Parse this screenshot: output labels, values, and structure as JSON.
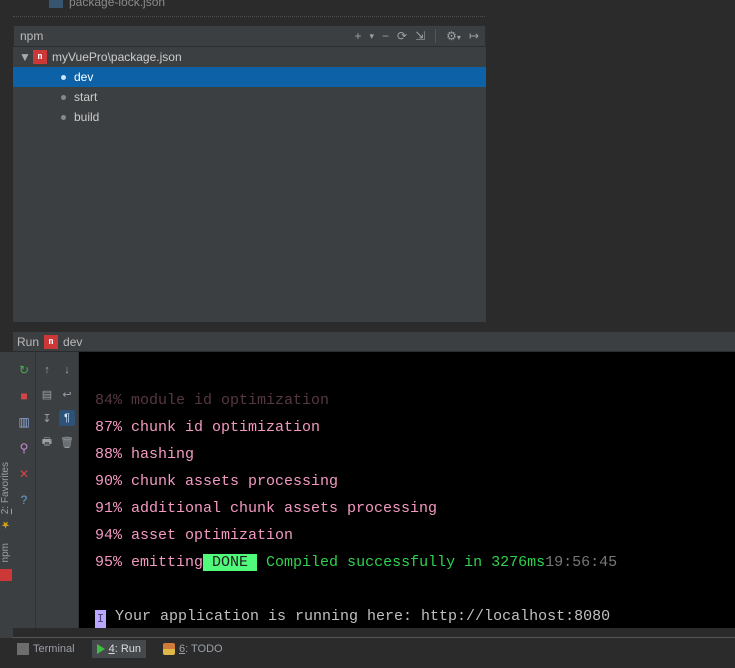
{
  "project_tree": {
    "visible_file": "package-lock.json"
  },
  "npm_toolwindow": {
    "title": "npm",
    "package_file": "myVuePro\\package.json",
    "npm_icon_text": "n",
    "scripts": [
      {
        "name": "dev",
        "selected": true
      },
      {
        "name": "start",
        "selected": false
      },
      {
        "name": "build",
        "selected": false
      }
    ],
    "toolbar": {
      "add": "+",
      "remove": "−",
      "sync": "⟳",
      "expand": "⇲",
      "settings": "⚙",
      "hide": "↦"
    }
  },
  "run_tool": {
    "label_prefix": "Run",
    "config_name": "dev",
    "npm_icon_text": "n"
  },
  "console": {
    "lines": [
      {
        "cls": "pink",
        "text": "87% chunk id optimization"
      },
      {
        "cls": "pink",
        "text": "88% hashing"
      },
      {
        "cls": "pink",
        "text": "90% chunk assets processing"
      },
      {
        "cls": "pink",
        "text": "91% additional chunk assets processing"
      },
      {
        "cls": "pink",
        "text": "94% asset optimization"
      }
    ],
    "emit_prefix": "95% emitting",
    "done_badge": " DONE ",
    "compiled_text": " Compiled successfully in 3276ms",
    "timestamp": "19:56:45",
    "caret_char": "I",
    "running_msg": " Your application is running here: http://localhost:8080"
  },
  "bottom_tabs": {
    "terminal": "Terminal",
    "run_mnemonic": "4",
    "run_suffix": ": Run",
    "todo_mnemonic": "6",
    "todo_suffix": ": TODO"
  },
  "side_rail": {
    "favorites_mnemonic": "2",
    "favorites_suffix": ": Favorites",
    "npm_label": "npm"
  }
}
